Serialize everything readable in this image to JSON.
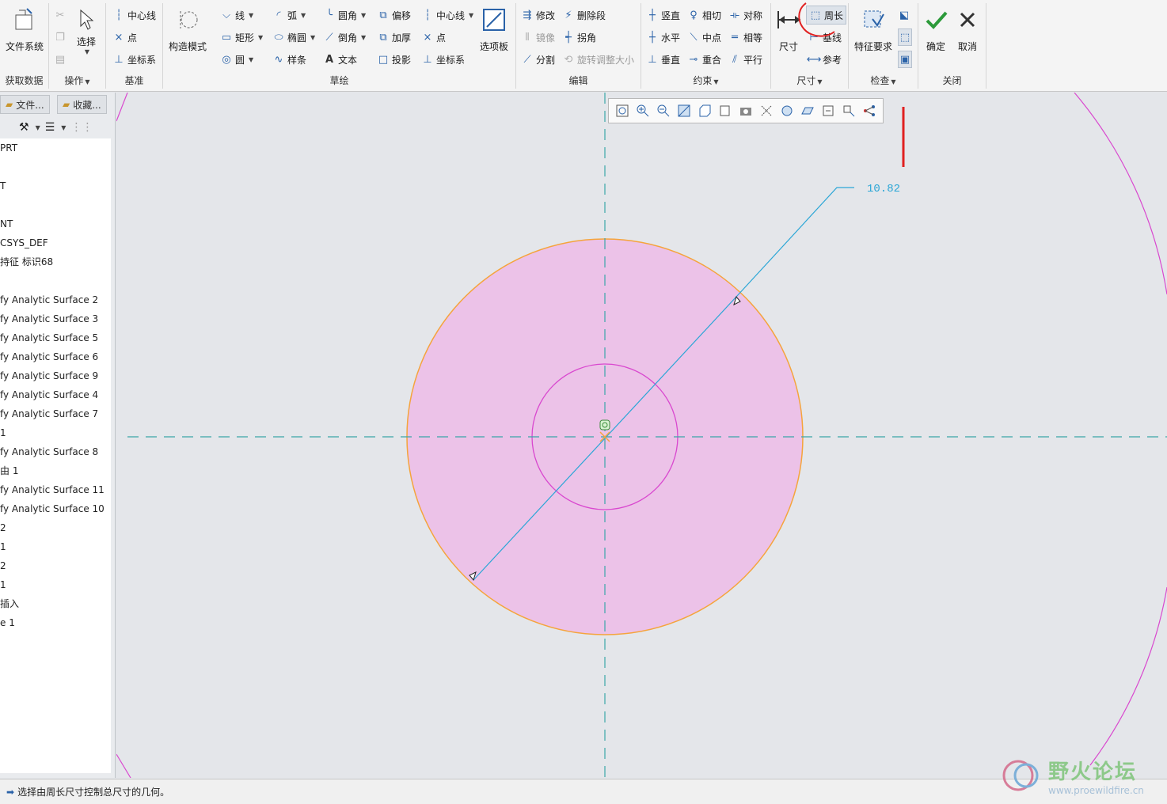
{
  "ribbon": {
    "get_data": {
      "group": "获取数据",
      "file_system": "文件系统"
    },
    "operations": {
      "group": "操作",
      "select": "选择"
    },
    "datum": {
      "group": "基准",
      "centerline": "中心线",
      "point": "点",
      "csys": "坐标系"
    },
    "sketch": {
      "group": "草绘",
      "construction_mode": "构造模式",
      "line": "线",
      "arc": "弧",
      "fillet": "圆角",
      "offset": "偏移",
      "centerline": "中心线",
      "rectangle": "矩形",
      "ellipse": "椭圆",
      "chamfer": "倒角",
      "thicken": "加厚",
      "point": "点",
      "circle": "圆",
      "spline": "样条",
      "text": "文本",
      "project": "投影",
      "csys": "坐标系",
      "palette": "选项板"
    },
    "edit": {
      "group": "编辑",
      "modify": "修改",
      "delete_segment": "删除段",
      "mirror": "镜像",
      "corner": "拐角",
      "divide": "分割",
      "rotate_resize": "旋转调整大小"
    },
    "constrain": {
      "group": "约束",
      "vertical": "竖直",
      "tangent": "相切",
      "symmetric": "对称",
      "horizontal": "水平",
      "midpoint": "中点",
      "equal": "相等",
      "perpendicular": "垂直",
      "coincident": "重合",
      "parallel": "平行"
    },
    "dimension": {
      "group": "尺寸",
      "dimension": "尺寸",
      "perimeter": "周长",
      "baseline": "基线",
      "reference": "参考"
    },
    "inspect": {
      "group": "检查",
      "feature_requirements": "特征要求"
    },
    "close": {
      "group": "关闭",
      "ok": "确定",
      "cancel": "取消"
    }
  },
  "left_panel": {
    "tabs": [
      "文件...",
      "收藏..."
    ],
    "tree": [
      "PRT",
      "T",
      "NT",
      "CSYS_DEF",
      "持征 标识68",
      "fy Analytic Surface 2",
      "fy Analytic Surface 3",
      "fy Analytic Surface 5",
      "fy Analytic Surface 6",
      "fy Analytic Surface 9",
      "fy Analytic Surface 4",
      "fy Analytic Surface 7",
      "1",
      "fy Analytic Surface 8",
      "由 1",
      "fy Analytic Surface 11",
      "fy Analytic Surface 10",
      "2",
      "1",
      "2",
      "1",
      "插入",
      "e 1"
    ]
  },
  "sketch": {
    "dimension_value": "10.82"
  },
  "status": {
    "message": "选择由周长尺寸控制总尺寸的几何。"
  },
  "watermark": {
    "text": "野火论坛",
    "url": "www.proewildfire.cn"
  },
  "colors": {
    "fill": "#ecc2e8",
    "outer_edge": "#f5a43c",
    "magenta": "#d948cf",
    "dim": "#2aa6d6",
    "centerline": "#3aa6a8",
    "annotation_red": "#e02020"
  }
}
